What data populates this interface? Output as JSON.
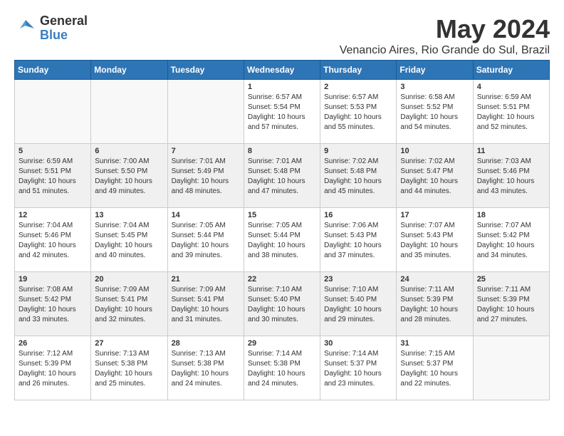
{
  "logo": {
    "general": "General",
    "blue": "Blue"
  },
  "title": "May 2024",
  "location": "Venancio Aires, Rio Grande do Sul, Brazil",
  "headers": [
    "Sunday",
    "Monday",
    "Tuesday",
    "Wednesday",
    "Thursday",
    "Friday",
    "Saturday"
  ],
  "weeks": [
    [
      {
        "day": "",
        "info": ""
      },
      {
        "day": "",
        "info": ""
      },
      {
        "day": "",
        "info": ""
      },
      {
        "day": "1",
        "info": "Sunrise: 6:57 AM\nSunset: 5:54 PM\nDaylight: 10 hours\nand 57 minutes."
      },
      {
        "day": "2",
        "info": "Sunrise: 6:57 AM\nSunset: 5:53 PM\nDaylight: 10 hours\nand 55 minutes."
      },
      {
        "day": "3",
        "info": "Sunrise: 6:58 AM\nSunset: 5:52 PM\nDaylight: 10 hours\nand 54 minutes."
      },
      {
        "day": "4",
        "info": "Sunrise: 6:59 AM\nSunset: 5:51 PM\nDaylight: 10 hours\nand 52 minutes."
      }
    ],
    [
      {
        "day": "5",
        "info": "Sunrise: 6:59 AM\nSunset: 5:51 PM\nDaylight: 10 hours\nand 51 minutes."
      },
      {
        "day": "6",
        "info": "Sunrise: 7:00 AM\nSunset: 5:50 PM\nDaylight: 10 hours\nand 49 minutes."
      },
      {
        "day": "7",
        "info": "Sunrise: 7:01 AM\nSunset: 5:49 PM\nDaylight: 10 hours\nand 48 minutes."
      },
      {
        "day": "8",
        "info": "Sunrise: 7:01 AM\nSunset: 5:48 PM\nDaylight: 10 hours\nand 47 minutes."
      },
      {
        "day": "9",
        "info": "Sunrise: 7:02 AM\nSunset: 5:48 PM\nDaylight: 10 hours\nand 45 minutes."
      },
      {
        "day": "10",
        "info": "Sunrise: 7:02 AM\nSunset: 5:47 PM\nDaylight: 10 hours\nand 44 minutes."
      },
      {
        "day": "11",
        "info": "Sunrise: 7:03 AM\nSunset: 5:46 PM\nDaylight: 10 hours\nand 43 minutes."
      }
    ],
    [
      {
        "day": "12",
        "info": "Sunrise: 7:04 AM\nSunset: 5:46 PM\nDaylight: 10 hours\nand 42 minutes."
      },
      {
        "day": "13",
        "info": "Sunrise: 7:04 AM\nSunset: 5:45 PM\nDaylight: 10 hours\nand 40 minutes."
      },
      {
        "day": "14",
        "info": "Sunrise: 7:05 AM\nSunset: 5:44 PM\nDaylight: 10 hours\nand 39 minutes."
      },
      {
        "day": "15",
        "info": "Sunrise: 7:05 AM\nSunset: 5:44 PM\nDaylight: 10 hours\nand 38 minutes."
      },
      {
        "day": "16",
        "info": "Sunrise: 7:06 AM\nSunset: 5:43 PM\nDaylight: 10 hours\nand 37 minutes."
      },
      {
        "day": "17",
        "info": "Sunrise: 7:07 AM\nSunset: 5:43 PM\nDaylight: 10 hours\nand 35 minutes."
      },
      {
        "day": "18",
        "info": "Sunrise: 7:07 AM\nSunset: 5:42 PM\nDaylight: 10 hours\nand 34 minutes."
      }
    ],
    [
      {
        "day": "19",
        "info": "Sunrise: 7:08 AM\nSunset: 5:42 PM\nDaylight: 10 hours\nand 33 minutes."
      },
      {
        "day": "20",
        "info": "Sunrise: 7:09 AM\nSunset: 5:41 PM\nDaylight: 10 hours\nand 32 minutes."
      },
      {
        "day": "21",
        "info": "Sunrise: 7:09 AM\nSunset: 5:41 PM\nDaylight: 10 hours\nand 31 minutes."
      },
      {
        "day": "22",
        "info": "Sunrise: 7:10 AM\nSunset: 5:40 PM\nDaylight: 10 hours\nand 30 minutes."
      },
      {
        "day": "23",
        "info": "Sunrise: 7:10 AM\nSunset: 5:40 PM\nDaylight: 10 hours\nand 29 minutes."
      },
      {
        "day": "24",
        "info": "Sunrise: 7:11 AM\nSunset: 5:39 PM\nDaylight: 10 hours\nand 28 minutes."
      },
      {
        "day": "25",
        "info": "Sunrise: 7:11 AM\nSunset: 5:39 PM\nDaylight: 10 hours\nand 27 minutes."
      }
    ],
    [
      {
        "day": "26",
        "info": "Sunrise: 7:12 AM\nSunset: 5:39 PM\nDaylight: 10 hours\nand 26 minutes."
      },
      {
        "day": "27",
        "info": "Sunrise: 7:13 AM\nSunset: 5:38 PM\nDaylight: 10 hours\nand 25 minutes."
      },
      {
        "day": "28",
        "info": "Sunrise: 7:13 AM\nSunset: 5:38 PM\nDaylight: 10 hours\nand 24 minutes."
      },
      {
        "day": "29",
        "info": "Sunrise: 7:14 AM\nSunset: 5:38 PM\nDaylight: 10 hours\nand 24 minutes."
      },
      {
        "day": "30",
        "info": "Sunrise: 7:14 AM\nSunset: 5:37 PM\nDaylight: 10 hours\nand 23 minutes."
      },
      {
        "day": "31",
        "info": "Sunrise: 7:15 AM\nSunset: 5:37 PM\nDaylight: 10 hours\nand 22 minutes."
      },
      {
        "day": "",
        "info": ""
      }
    ]
  ]
}
